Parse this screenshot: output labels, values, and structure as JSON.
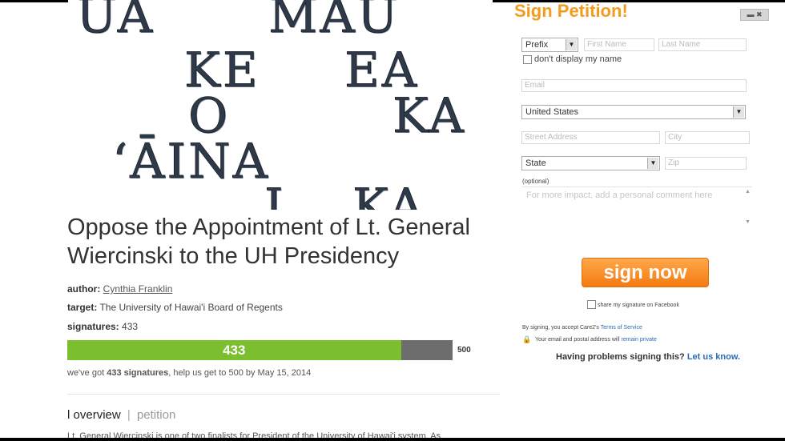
{
  "hero": {
    "words": [
      "UA",
      "MAU",
      "KE",
      "EA",
      "O",
      "KA",
      "ʻĀINA",
      "I",
      "KA"
    ]
  },
  "petition": {
    "title": "Oppose the Appointment of Lt. General Wiercinski to the UH Presidency",
    "author_label": "author:",
    "author": "Cynthia Franklin",
    "target_label": "target:",
    "target": "The University of Hawai'i Board of Regents",
    "signatures_label": "signatures:",
    "signatures": "433",
    "progress": {
      "value": 433,
      "goal": 500,
      "fraction": 0.866,
      "value_label": "433",
      "goal_label": "500"
    },
    "progress_text_a": "we've got",
    "progress_text_b": "433 signatures",
    "progress_text_c": ", help us get to 500 by May 15, 2014",
    "snippet": "Lt. General Wiercinski is one of two finalists for President of the University of Hawai'i system. As"
  },
  "tabs": {
    "active": "overview",
    "sep": "|",
    "inactive": "petition",
    "prefix": "l"
  },
  "form": {
    "heading": "Sign Petition!",
    "close_label": "▬ ✖",
    "prefix": "Prefix",
    "first_name_placeholder": "First Name",
    "last_name_placeholder": "Last Name",
    "dont_display": "don't display my name",
    "email_placeholder": "Email",
    "country": "United States",
    "street_placeholder": "Street Address",
    "city_placeholder": "City",
    "state": "State",
    "zip_placeholder": "Zip",
    "optional": "(optional)",
    "comment_placeholder": "For more impact, add a personal comment here",
    "sign_button": "sign now",
    "share_facebook": "share my signature on Facebook",
    "terms_a": "By signing, you accept Care2's",
    "terms_link": "Terms of Service",
    "privacy_a": "Your email and postal address will",
    "privacy_link": "remain private",
    "problems_a": "Having problems signing this?",
    "problems_link": "Let us know."
  },
  "colors": {
    "accent": "#f29b1d",
    "progress_fill": "#7bbf2e",
    "progress_bg": "#6d6d6d",
    "link": "#2a6bb5"
  },
  "icons": [
    "dropdown-arrow-icon",
    "lock-icon",
    "checkbox-icon"
  ]
}
